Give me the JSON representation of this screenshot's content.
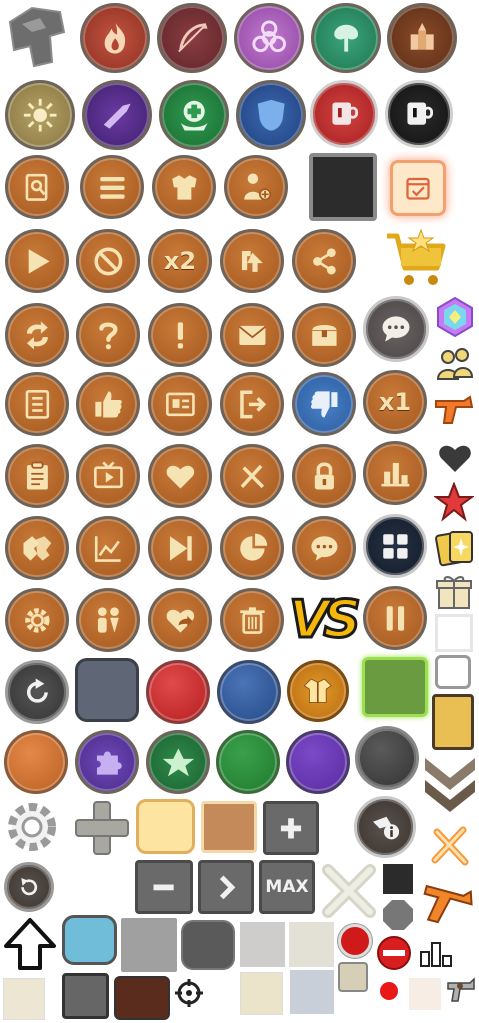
{
  "sheet": {
    "labels": {
      "x2": "x2",
      "x1": "x1",
      "max": "MAX",
      "vs": "VS"
    }
  },
  "colors": {
    "orange_button": "#b3642a",
    "cream_icon": "#f6e3b3",
    "dark_ring": "#6e6359",
    "red_orb": "#cc2a2a",
    "blue_orb": "#2e5a9a",
    "green_orb": "#2e8a3e",
    "purple_orb": "#6f3eb5",
    "gold_chip": "#f0c060",
    "slot_green": "#6b9b40"
  }
}
